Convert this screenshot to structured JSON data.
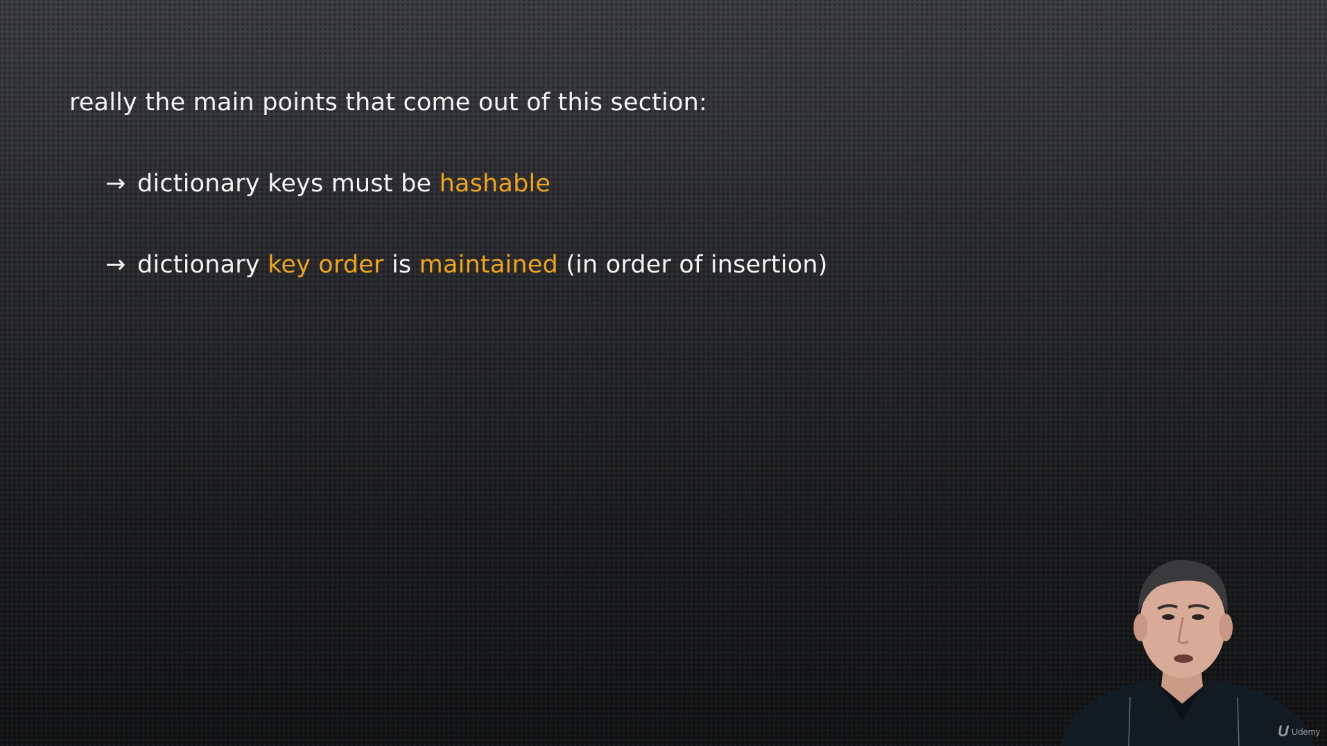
{
  "slide": {
    "heading": "really the main points that come out of this section:",
    "bullets": [
      {
        "arrow": "→",
        "segments": [
          "dictionary keys must be ",
          "hashable"
        ]
      },
      {
        "arrow": "→",
        "segments": [
          "dictionary ",
          "key order",
          " is ",
          "maintained",
          " (in order of insertion)"
        ]
      }
    ],
    "highlight_color": "#f0a31c",
    "text_color": "#f4f4f4"
  },
  "presenter": {
    "icon": "presenter-video-icon"
  },
  "watermark": {
    "logo": "U",
    "text": "Udemy",
    "icon": "udemy-logo-icon"
  }
}
